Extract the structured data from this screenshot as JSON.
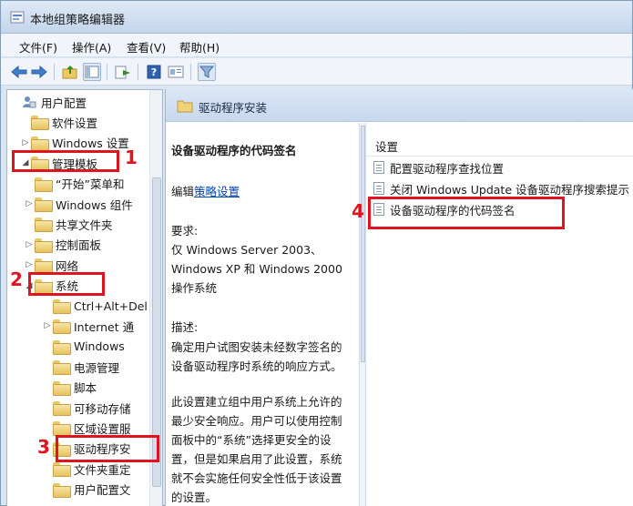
{
  "window": {
    "title": "本地组策略编辑器"
  },
  "menu": [
    "文件(F)",
    "操作(A)",
    "查看(V)",
    "帮助(H)"
  ],
  "toolbar": {
    "buttons": [
      "back-icon",
      "forward-icon",
      "up-folder-icon",
      "show-hide-tree-icon",
      "export-list-icon",
      "help-icon",
      "properties-icon",
      "filter-icon"
    ]
  },
  "tree": [
    {
      "label": "用户配置",
      "indent": 0,
      "arrow": "",
      "icon": "user-config-icon"
    },
    {
      "label": "软件设置",
      "indent": 1,
      "arrow": "",
      "icon": "folder-icon"
    },
    {
      "label": "Windows 设置",
      "indent": 1,
      "arrow": "▷",
      "icon": "folder-icon"
    },
    {
      "label": "管理模板",
      "indent": 1,
      "arrow": "◢",
      "icon": "folder-icon"
    },
    {
      "label": "“开始”菜单和",
      "indent": 2,
      "arrow": "",
      "icon": "folder-icon"
    },
    {
      "label": "Windows 组件",
      "indent": 2,
      "arrow": "▷",
      "icon": "folder-icon"
    },
    {
      "label": "共享文件夹",
      "indent": 2,
      "arrow": "",
      "icon": "folder-icon"
    },
    {
      "label": "控制面板",
      "indent": 2,
      "arrow": "▷",
      "icon": "folder-icon"
    },
    {
      "label": "网络",
      "indent": 2,
      "arrow": "▷",
      "icon": "folder-icon"
    },
    {
      "label": "系统",
      "indent": 2,
      "arrow": "◢",
      "icon": "folder-icon"
    },
    {
      "label": "Ctrl+Alt+Del",
      "indent": 3,
      "arrow": "",
      "icon": "folder-icon"
    },
    {
      "label": "Internet 通",
      "indent": 3,
      "arrow": "▷",
      "icon": "folder-icon"
    },
    {
      "label": "Windows",
      "indent": 3,
      "arrow": "",
      "icon": "folder-icon"
    },
    {
      "label": "电源管理",
      "indent": 3,
      "arrow": "",
      "icon": "folder-icon"
    },
    {
      "label": "脚本",
      "indent": 3,
      "arrow": "",
      "icon": "folder-icon"
    },
    {
      "label": "可移动存储",
      "indent": 3,
      "arrow": "",
      "icon": "folder-icon"
    },
    {
      "label": "区域设置服",
      "indent": 3,
      "arrow": "",
      "icon": "folder-icon"
    },
    {
      "label": "驱动程序安",
      "indent": 3,
      "arrow": "",
      "icon": "folder-icon"
    },
    {
      "label": "文件夹重定",
      "indent": 3,
      "arrow": "",
      "icon": "folder-icon"
    },
    {
      "label": "用户配置文",
      "indent": 3,
      "arrow": "",
      "icon": "folder-icon"
    }
  ],
  "right_header": "驱动程序安装",
  "description": {
    "title": "设备驱动程序的代码签名",
    "edit_prefix": "编辑",
    "edit_link": "策略设置",
    "requirements_label": "要求:",
    "requirements_lines": [
      "仅 Windows Server 2003、",
      "Windows XP 和 Windows 2000",
      "操作系统"
    ],
    "description_label": "描述:",
    "description_lines": [
      "确定用户试图安装未经数字签名的",
      "设备驱动程序时系统的响应方式。"
    ],
    "extra_lines": [
      "此设置建立组中用户系统上允许的",
      "最少安全响应。用户可以使用控制",
      "面板中的“系统”选择更安全的设",
      "置，但是如果启用了此设置，系统",
      "就不会实施任何安全性低于该设置",
      "的设置。"
    ]
  },
  "settings": {
    "header": "设置",
    "items": [
      "配置驱动程序查找位置",
      "关闭 Windows Update 设备驱动程序搜索提示",
      "设备驱动程序的代码签名"
    ]
  },
  "annotations": [
    "1",
    "2",
    "3",
    "4"
  ],
  "colors": {
    "annotation_red": "#e0141e",
    "link_blue": "#0645ad"
  }
}
